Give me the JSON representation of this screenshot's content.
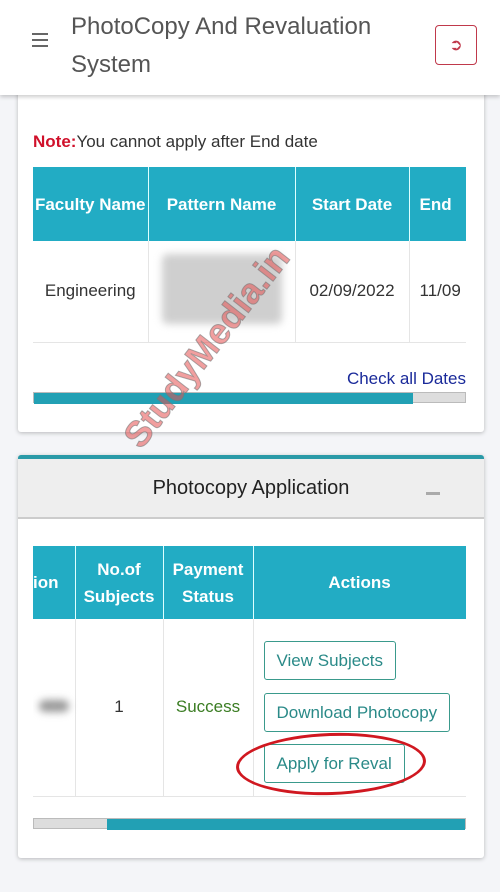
{
  "header": {
    "title": "PhotoCopy And Revaluation System",
    "menu_icon": "hamburger-icon",
    "logout_icon": "sign-out-icon"
  },
  "dates_card": {
    "note_label": "Note:",
    "note_text": "You cannot apply after End date",
    "columns": [
      "Faculty Name",
      "Pattern Name",
      "Start Date",
      "End"
    ],
    "rows": [
      {
        "faculty": "Engineering",
        "pattern": "",
        "start": "02/09/2022",
        "end": "11/09"
      }
    ],
    "check_link": "Check all Dates",
    "scroll_position_percent": 88
  },
  "photocopy_card": {
    "title": "Photocopy Application",
    "collapse_icon": "minus-icon",
    "columns": [
      "ion",
      "No.of Subjects",
      "Payment Status",
      "Actions"
    ],
    "rows": [
      {
        "id": "",
        "subjects": "1",
        "status": "Success"
      }
    ],
    "actions": {
      "view": "View Subjects",
      "download": "Download Photocopy",
      "reval": "Apply for Reval"
    },
    "scroll_position_percent": 100
  },
  "watermark": "StudyMedia.in",
  "colors": {
    "accent": "#22acc4",
    "note": "#d0102a",
    "success": "#3b7d23",
    "highlight": "#d01820"
  }
}
